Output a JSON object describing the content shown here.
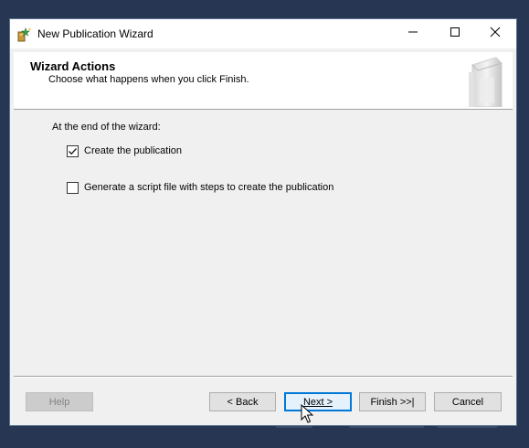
{
  "window": {
    "title": "New Publication Wizard",
    "icon": "wizard-app-icon",
    "controls": {
      "minimize": "minimize-icon",
      "maximize": "maximize-icon",
      "close": "close-icon"
    }
  },
  "header": {
    "title": "Wizard Actions",
    "subtitle": "Choose what happens when you click Finish."
  },
  "content": {
    "section_label": "At the end of the wizard:",
    "options": [
      {
        "label": "Create the publication",
        "checked": true
      },
      {
        "label": "Generate a script file with steps to create the publication",
        "checked": false
      }
    ]
  },
  "buttons": {
    "help": "Help",
    "back": "< Back",
    "next": "Next >",
    "finish": "Finish >>|",
    "cancel": "Cancel"
  },
  "colors": {
    "desktop": "#263653",
    "window_bg": "#f0f0f0",
    "focus_border": "#0078d7"
  }
}
